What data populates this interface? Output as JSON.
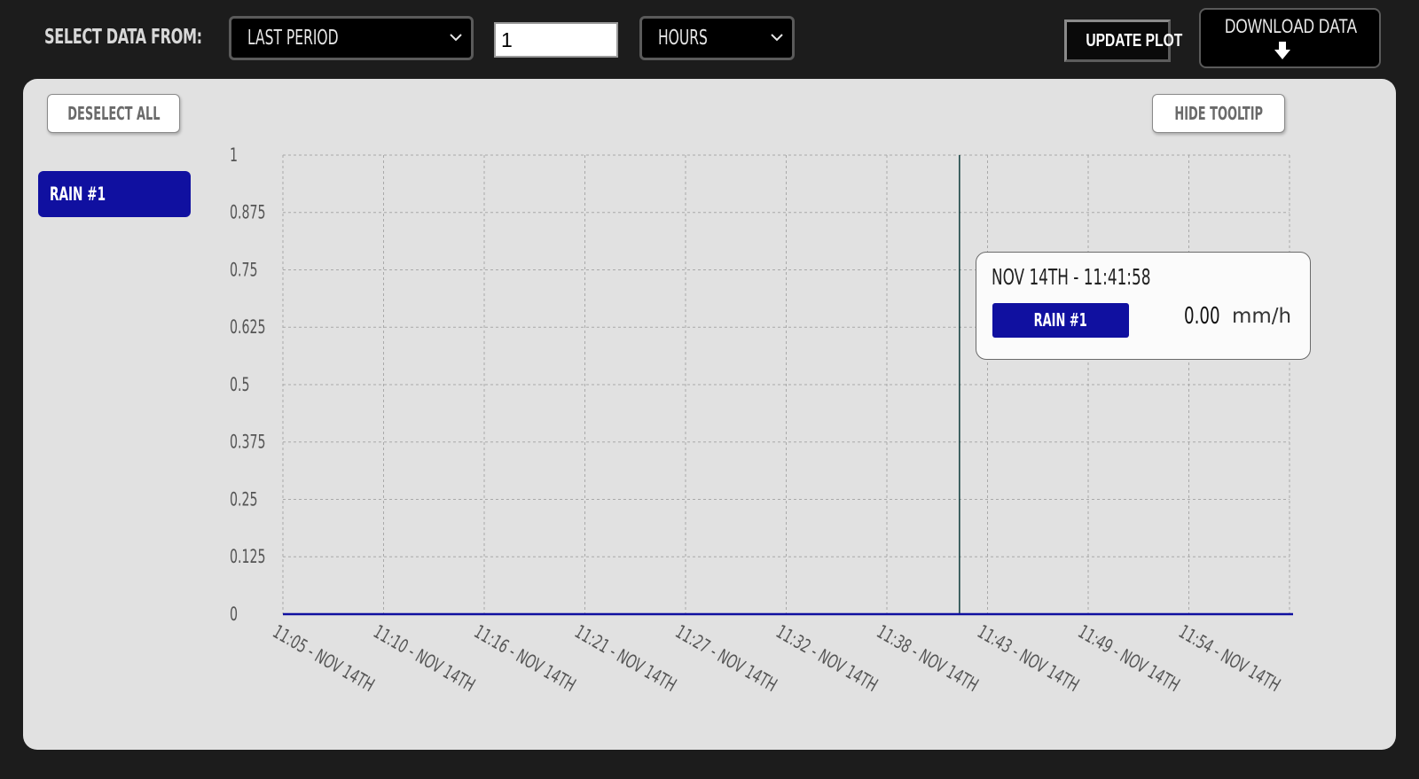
{
  "toolbar": {
    "select_label": "SELECT DATA FROM:",
    "period_select": "LAST PERIOD",
    "amount_value": "1",
    "unit_select": "HOURS",
    "update_label": "UPDATE PLOT",
    "download_label": "DOWNLOAD DATA",
    "download_icon": "arrow-down-icon"
  },
  "panel": {
    "deselect_label": "DESELECT ALL",
    "hide_tooltip_label": "HIDE TOOLTIP",
    "series_buttons": [
      "RAIN #1"
    ]
  },
  "tooltip": {
    "time": "NOV 14TH - 11:41:58",
    "series": "RAIN #1",
    "value": "0.00",
    "unit": "mm/h"
  },
  "colors": {
    "series": "#1010a0",
    "background": "#1c1c1c",
    "panel": "#e1e1e1",
    "cursor": "#0d3b3b"
  },
  "chart_data": {
    "type": "line",
    "grid": true,
    "ylim": [
      0,
      1
    ],
    "yticks": [
      "0",
      "0.125",
      "0.25",
      "0.375",
      "0.5",
      "0.625",
      "0.75",
      "0.875",
      "1"
    ],
    "xticks": [
      "11:05 - NOV 14TH",
      "11:10 - NOV 14TH",
      "11:16 - NOV 14TH",
      "11:21 - NOV 14TH",
      "11:27 - NOV 14TH",
      "11:32 - NOV 14TH",
      "11:38 - NOV 14TH",
      "11:43 - NOV 14TH",
      "11:49 - NOV 14TH",
      "11:54 - NOV 14TH"
    ],
    "series": [
      {
        "name": "RAIN #1",
        "x": [
          "11:05 - NOV 14TH",
          "11:54 - NOV 14TH"
        ],
        "values": [
          0,
          0
        ]
      }
    ],
    "cursor_x": "11:41:58 - NOV 14TH"
  }
}
